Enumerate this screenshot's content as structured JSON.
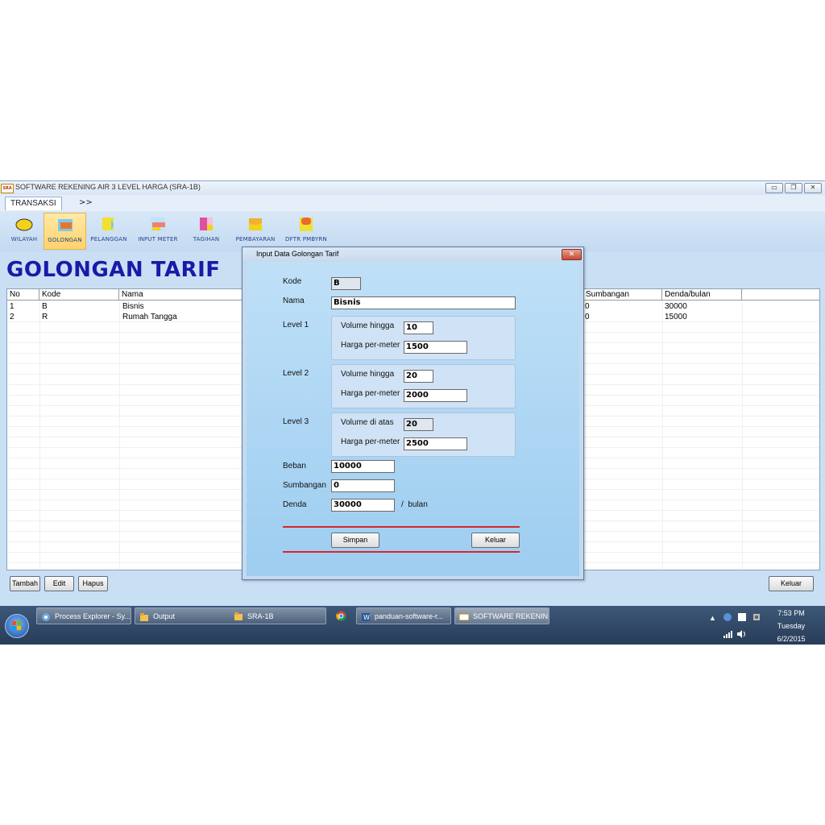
{
  "window": {
    "title": "SOFTWARE REKENING AIR 3 LEVEL HARGA (SRA-1B)",
    "logo_text": "SRA",
    "controls": {
      "minimize": "▭",
      "restore": "❐",
      "close": "✕"
    }
  },
  "menu": {
    "tab": "TRANSAKSI",
    "more": ">>"
  },
  "toolbar": [
    {
      "label": "WILAYAH",
      "icon": "wilayah-icon",
      "color": "#f2d21b"
    },
    {
      "label": "GOLONGAN",
      "icon": "golongan-icon",
      "color": "#e8762a"
    },
    {
      "label": "PELANGGAN",
      "icon": "pelanggan-icon",
      "color": "#f0e030"
    },
    {
      "label": "INPUT METER",
      "icon": "input-meter-icon",
      "color": "#f08070"
    },
    {
      "label": "TAGIHAN",
      "icon": "tagihan-icon",
      "color": "#e050a0"
    },
    {
      "label": "PEMBAYARAN",
      "icon": "pembayaran-icon",
      "color": "#f2b030"
    },
    {
      "label": "DFTR PMBYRN",
      "icon": "daftar-pembayaran-icon",
      "color": "#e86a30"
    }
  ],
  "page_title": "GOLONGAN TARIF",
  "table": {
    "headers": [
      "No",
      "Kode",
      "Nama",
      "Sumbangan",
      "Denda/bulan"
    ],
    "rows": [
      {
        "no": "1",
        "kode": "B",
        "nama": "Bisnis",
        "sumbangan": "0",
        "denda": "30000"
      },
      {
        "no": "2",
        "kode": "R",
        "nama": "Rumah Tangga",
        "sumbangan": "0",
        "denda": "15000"
      }
    ]
  },
  "actions": {
    "tambah": "Tambah",
    "edit": "Edit",
    "hapus": "Hapus",
    "keluar": "Keluar"
  },
  "dialog": {
    "title": "Input Data Golongan Tarif",
    "close": "✕",
    "kode_label": "Kode",
    "kode_value": "B",
    "nama_label": "Nama",
    "nama_value": "Bisnis",
    "level1": {
      "label": "Level 1",
      "vol_label": "Volume hingga",
      "vol_value": "10",
      "harga_label": "Harga per-meter",
      "harga_value": "1500"
    },
    "level2": {
      "label": "Level 2",
      "vol_label": "Volume hingga",
      "vol_value": "20",
      "harga_label": "Harga per-meter",
      "harga_value": "2000"
    },
    "level3": {
      "label": "Level 3",
      "vol_label": "Volume di atas",
      "vol_value": "20",
      "harga_label": "Harga per-meter",
      "harga_value": "2500"
    },
    "beban_label": "Beban",
    "beban_value": "10000",
    "sumbangan_label": "Sumbangan",
    "sumbangan_value": "0",
    "denda_label": "Denda",
    "denda_value": "30000",
    "denda_unit": "/  bulan",
    "simpan": "Simpan",
    "keluar": "Keluar"
  },
  "taskbar": {
    "items": [
      {
        "label": "Process Explorer - Sy...",
        "icon": "process-explorer-icon"
      },
      {
        "label": "Output",
        "icon": "folder-icon"
      },
      {
        "label": "SRA-1B",
        "icon": "folder-icon"
      },
      {
        "label": "panduan-software-r...",
        "icon": "word-icon"
      },
      {
        "label": "SOFTWARE REKENIN...",
        "icon": "sra-app-icon"
      }
    ],
    "chrome_icon": "chrome-icon",
    "clock": {
      "time": "7:53 PM",
      "day": "Tuesday",
      "date": "6/2/2015"
    },
    "tray_expand": "▲"
  }
}
